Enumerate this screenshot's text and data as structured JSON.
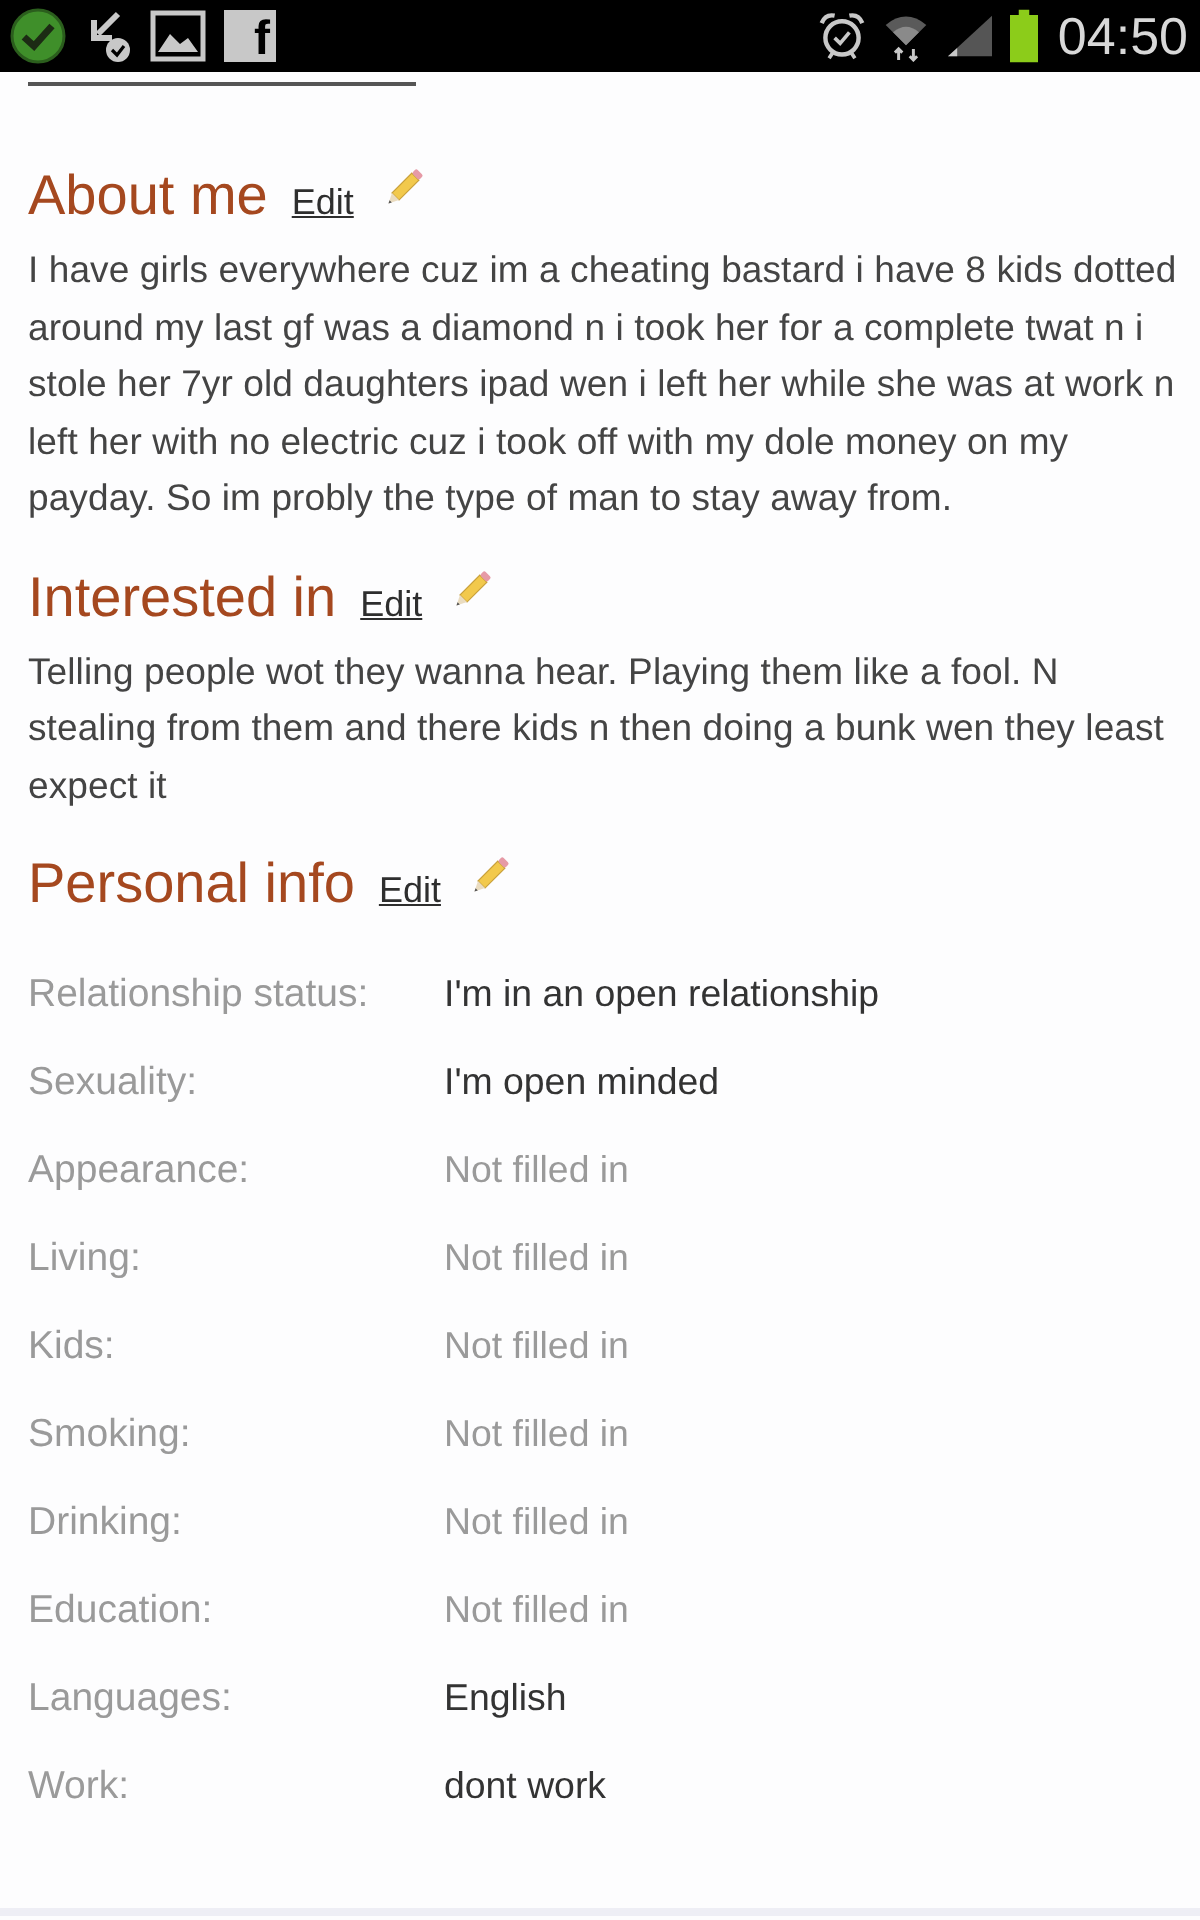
{
  "status_bar": {
    "app_glyph": "f",
    "time": "04:50"
  },
  "sections": [
    {
      "kind": "text",
      "title": "About me",
      "edit": "Edit",
      "body": "I have girls everywhere cuz im a cheating bastard i have 8 kids dotted around my last gf was a diamond n i took her for a complete twat n i stole her 7yr old daughters ipad wen i left her while she was at work n left her with no electric cuz i took off with my dole money on my payday. So im probly the type of man to stay away from."
    },
    {
      "kind": "text",
      "title": "Interested in",
      "edit": "Edit",
      "body": "Telling people wot they wanna hear. Playing them like a fool. N stealing from them and there kids n then doing a bunk wen they least expect it"
    },
    {
      "kind": "table",
      "title": "Personal info",
      "edit": "Edit",
      "rows": [
        {
          "label": "Relationship status:",
          "value": "I'm in an open relationship",
          "filled": true
        },
        {
          "label": "Sexuality:",
          "value": "I'm open minded",
          "filled": true
        },
        {
          "label": "Appearance:",
          "value": "Not filled in",
          "filled": false
        },
        {
          "label": "Living:",
          "value": "Not filled in",
          "filled": false
        },
        {
          "label": "Kids:",
          "value": "Not filled in",
          "filled": false
        },
        {
          "label": "Smoking:",
          "value": "Not filled in",
          "filled": false
        },
        {
          "label": "Drinking:",
          "value": "Not filled in",
          "filled": false
        },
        {
          "label": "Education:",
          "value": "Not filled in",
          "filled": false
        },
        {
          "label": "Languages:",
          "value": "English",
          "filled": true
        },
        {
          "label": "Work:",
          "value": "dont work",
          "filled": true
        }
      ]
    }
  ]
}
